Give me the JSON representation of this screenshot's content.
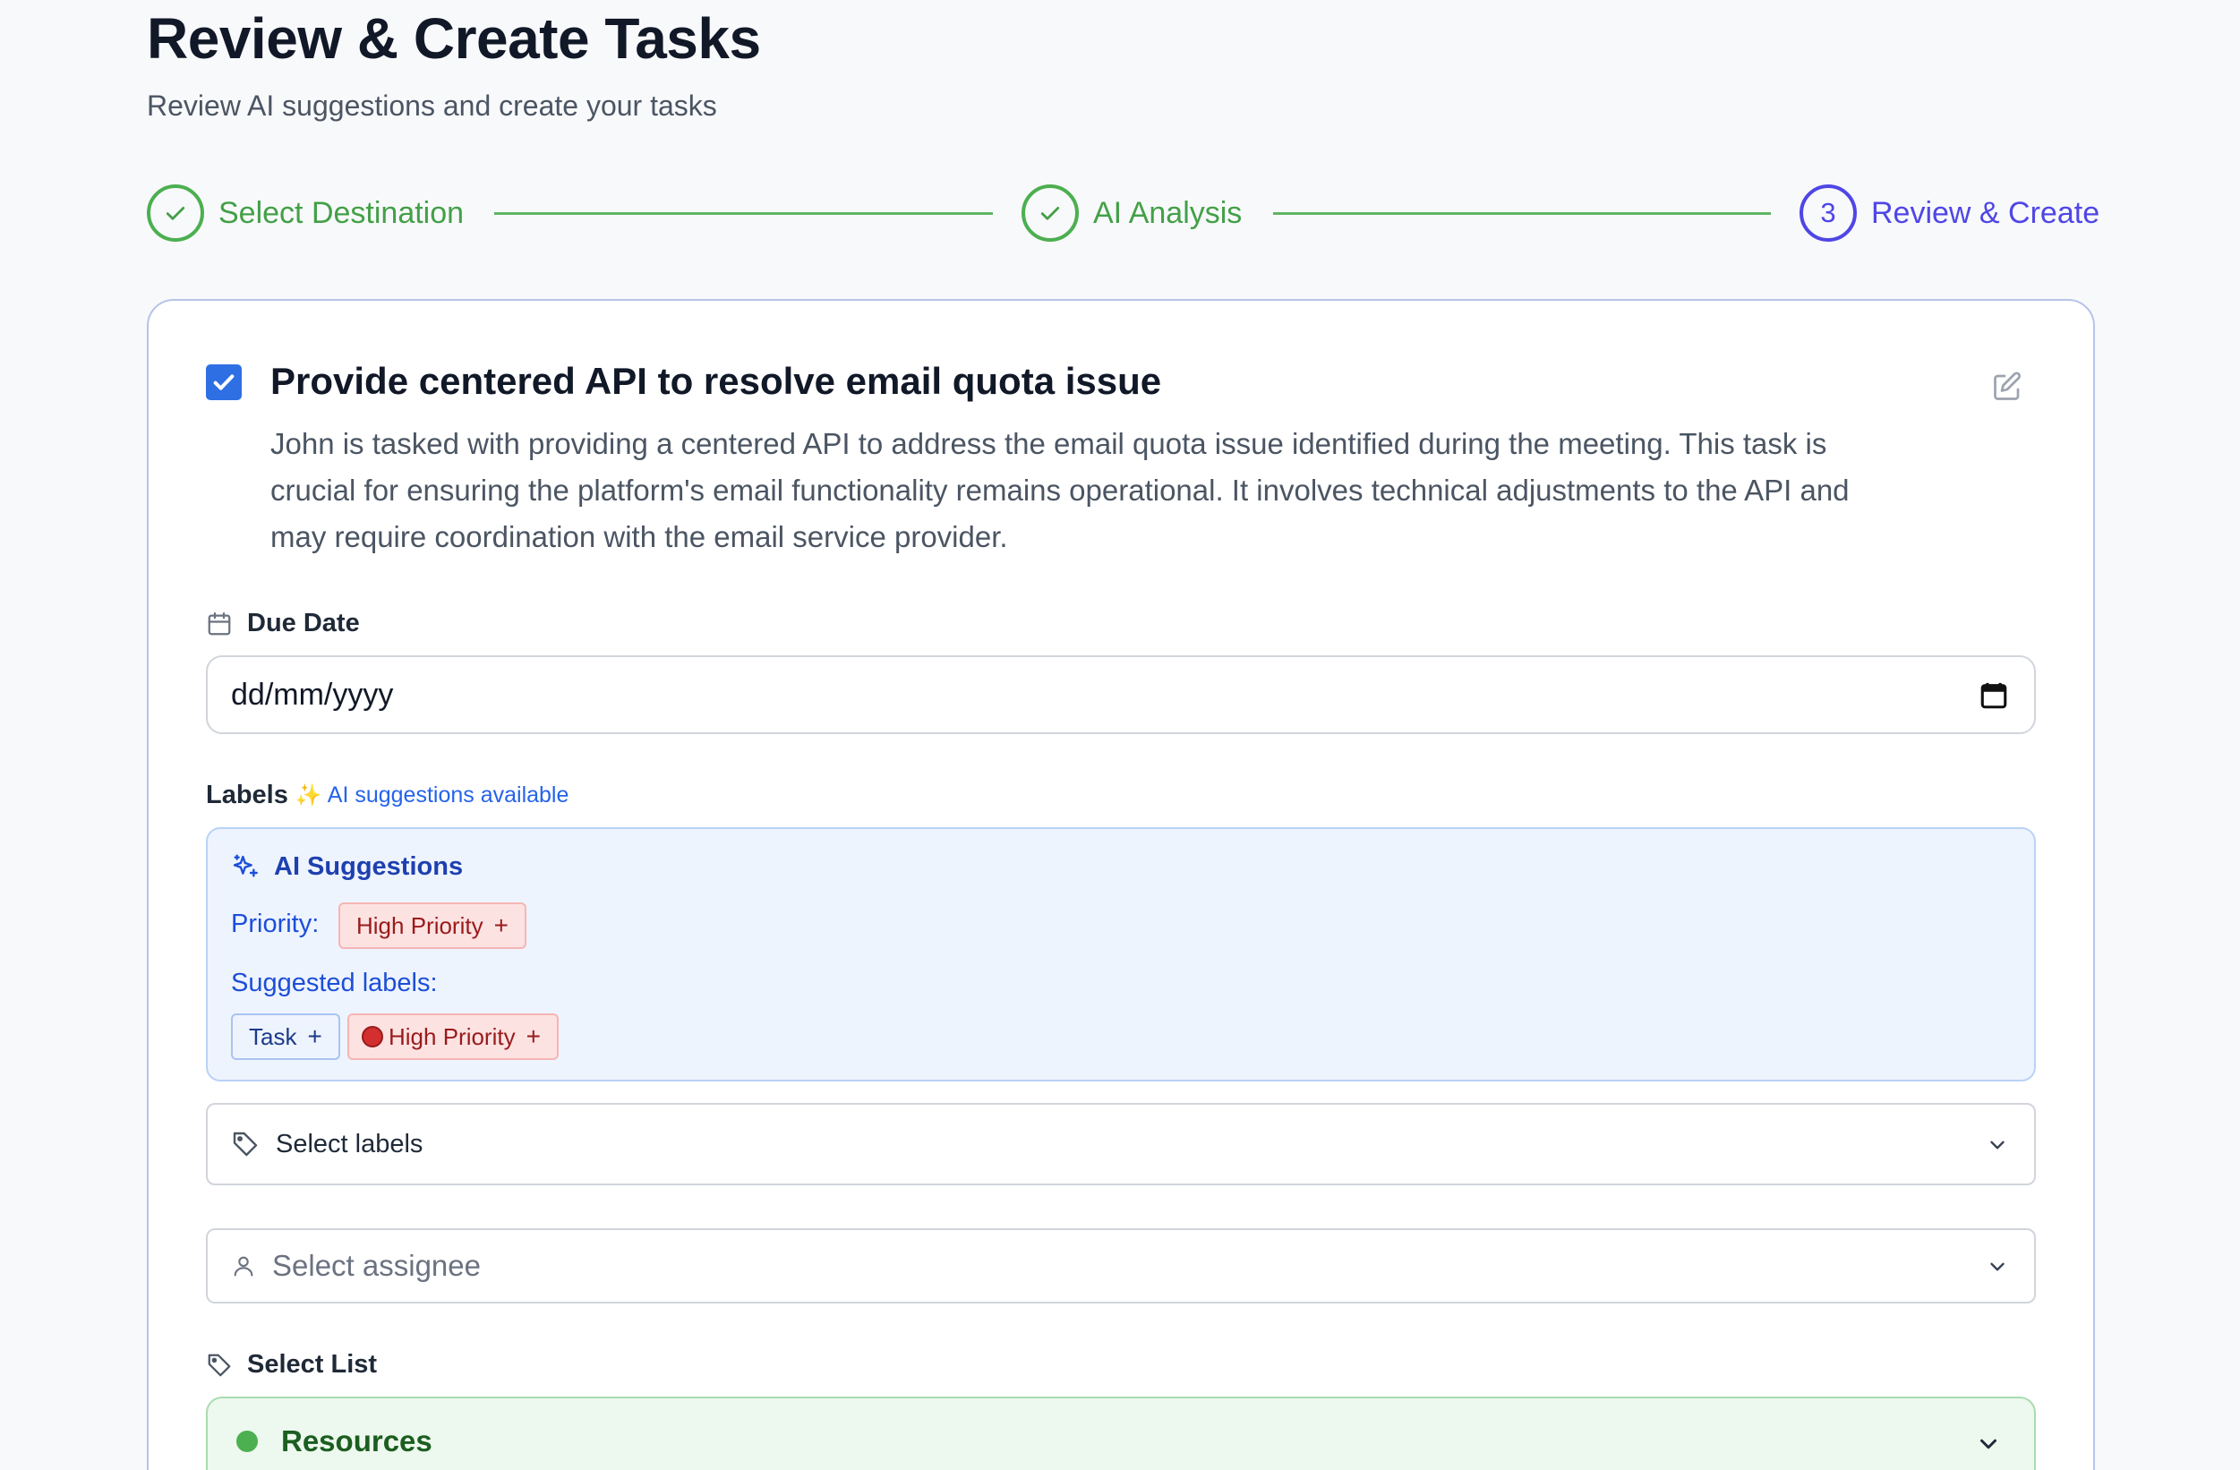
{
  "header": {
    "title": "Review & Create Tasks",
    "subtitle": "Review AI suggestions and create your tasks"
  },
  "stepper": {
    "steps": [
      {
        "label": "Select Destination",
        "state": "done"
      },
      {
        "label": "AI Analysis",
        "state": "done"
      },
      {
        "label": "Review & Create",
        "state": "active",
        "number": "3"
      }
    ]
  },
  "task": {
    "checked": true,
    "title": "Provide centered API to resolve email quota issue",
    "description_lines": [
      "John is tasked with providing a centered API to address the email quota issue identified during the meeting. This task is",
      "crucial for ensuring the platform's email functionality remains operational. It involves technical adjustments to the API and",
      "may require coordination with the email service provider."
    ]
  },
  "due_date": {
    "label": "Due Date",
    "placeholder": "dd/mm/yyyy"
  },
  "labels": {
    "label": "Labels",
    "ai_hint_icon": "✨",
    "ai_hint": "AI suggestions available"
  },
  "ai_suggestions": {
    "title": "AI Suggestions",
    "priority_label": "Priority:",
    "priority_chip": "High Priority",
    "suggested_label": "Suggested labels:",
    "suggested_chips": [
      "Task",
      "High Priority"
    ],
    "plus": "+"
  },
  "select_labels": {
    "placeholder": "Select labels"
  },
  "select_assignee": {
    "placeholder": "Select assignee"
  },
  "select_list": {
    "label": "Select List",
    "value": "Resources"
  },
  "colors": {
    "success": "#43a047",
    "active": "#4f46e5",
    "checkbox": "#2f6fe4",
    "ai_box_bg": "#eef4fe",
    "list_bg": "#edf8ee"
  }
}
